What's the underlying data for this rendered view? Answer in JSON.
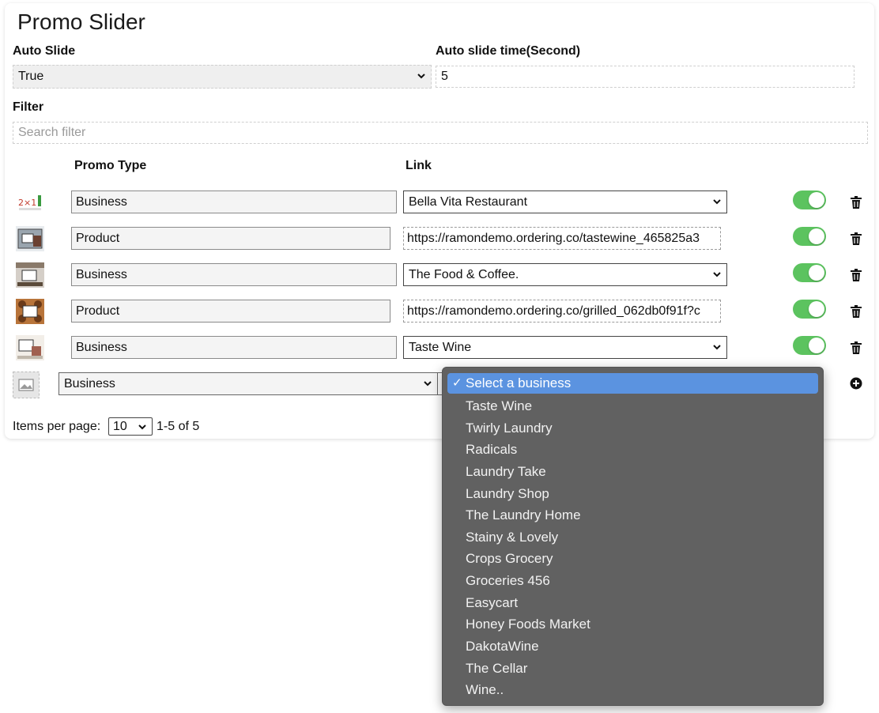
{
  "page": {
    "title": "Promo Slider",
    "auto_slide_label": "Auto Slide",
    "auto_slide_value": "True",
    "auto_slide_time_label": "Auto slide time(Second)",
    "auto_slide_time_value": "5",
    "filter_label": "Filter",
    "filter_placeholder": "Search filter"
  },
  "table": {
    "headers": {
      "promo_type": "Promo Type",
      "link": "Link"
    },
    "rows": [
      {
        "type": "Business",
        "link": "Bella Vita Restaurant",
        "link_kind": "select",
        "enabled": true
      },
      {
        "type": "Product",
        "link": "https://ramondemo.ordering.co/tastewine_465825a3",
        "link_kind": "url",
        "enabled": true
      },
      {
        "type": "Business",
        "link": "The Food & Coffee.",
        "link_kind": "select",
        "enabled": true
      },
      {
        "type": "Product",
        "link": "https://ramondemo.ordering.co/grilled_062db0f91f?c",
        "link_kind": "url",
        "enabled": true
      },
      {
        "type": "Business",
        "link": "Taste Wine",
        "link_kind": "select",
        "enabled": true
      }
    ],
    "new_row": {
      "type": "Business"
    }
  },
  "pagination": {
    "label": "Items per page:",
    "per_page": "10",
    "range": "1-5 of 5"
  },
  "dropdown": {
    "selected": "Select a business",
    "check": "✓",
    "options": [
      "Taste Wine",
      "Twirly Laundry",
      "Radicals",
      "Laundry Take",
      "Laundry Shop",
      "The Laundry Home",
      "Stainy & Lovely",
      "Crops Grocery",
      "Groceries 456",
      "Easycart",
      "Honey Foods Market",
      "DakotaWine",
      "The Cellar",
      "Wine.."
    ]
  },
  "colors": {
    "toggle_on": "#5cc35f",
    "dropdown_bg": "#616161",
    "dropdown_highlight": "#5b93e0"
  },
  "icons": [
    "chevron-down-icon",
    "trash-icon",
    "add-circle-icon",
    "image-placeholder-icon"
  ]
}
